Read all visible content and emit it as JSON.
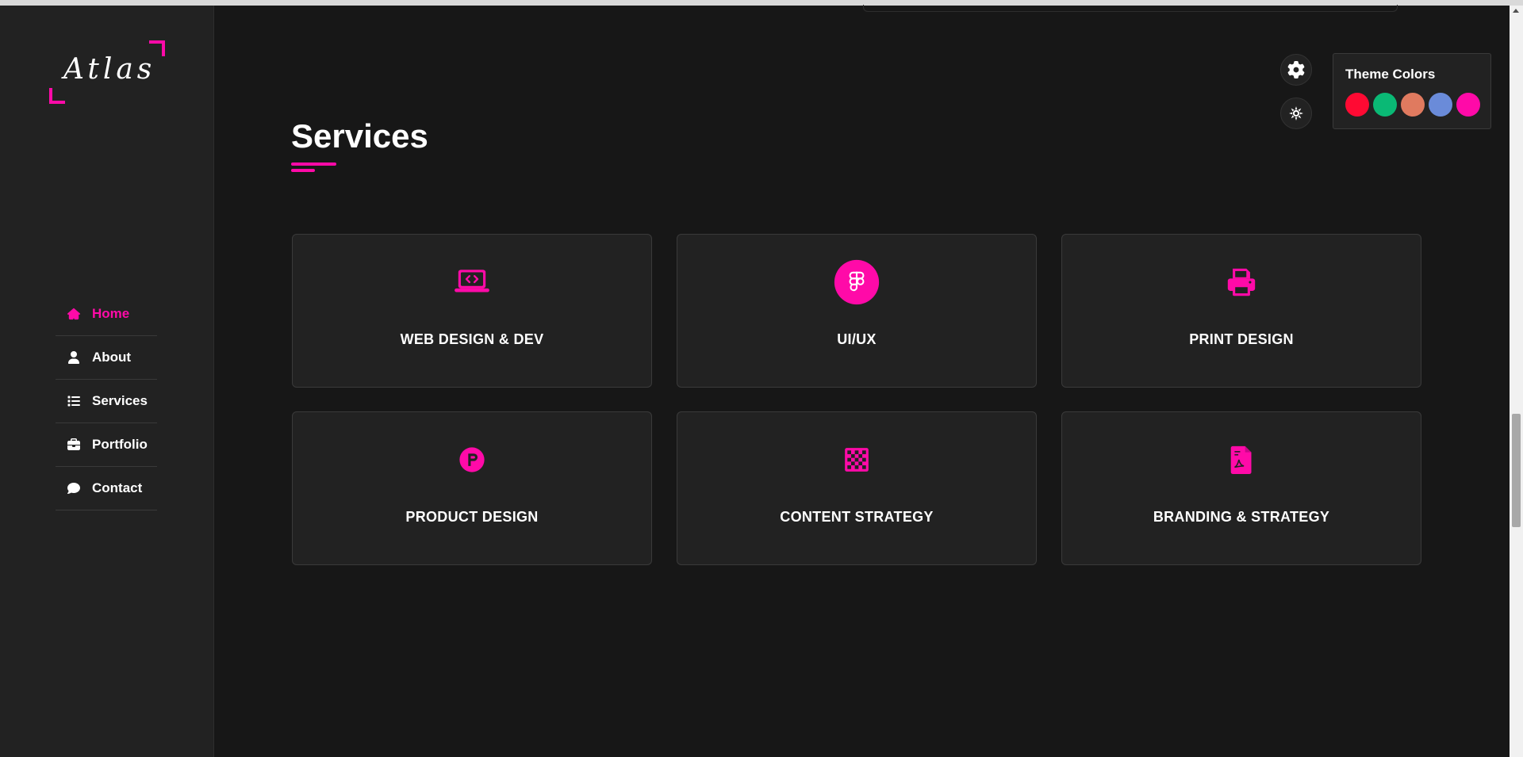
{
  "logo": {
    "text": "Atlas"
  },
  "nav": {
    "items": [
      {
        "label": "Home",
        "icon": "home-icon",
        "active": true
      },
      {
        "label": "About",
        "icon": "user-icon",
        "active": false
      },
      {
        "label": "Services",
        "icon": "list-icon",
        "active": false
      },
      {
        "label": "Portfolio",
        "icon": "briefcase-icon",
        "active": false
      },
      {
        "label": "Contact",
        "icon": "comment-icon",
        "active": false
      }
    ]
  },
  "main": {
    "title": "Services",
    "services": [
      {
        "title": "WEB DESIGN & DEV",
        "icon": "laptop-code-icon"
      },
      {
        "title": "UI/UX",
        "icon": "figma-icon"
      },
      {
        "title": "PRINT DESIGN",
        "icon": "printer-icon"
      },
      {
        "title": "PRODUCT DESIGN",
        "icon": "product-hunt-icon"
      },
      {
        "title": "CONTENT STRATEGY",
        "icon": "chess-board-icon"
      },
      {
        "title": "BRANDING & STRATEGY",
        "icon": "file-pdf-icon"
      }
    ]
  },
  "theme": {
    "title": "Theme Colors",
    "swatches": [
      "#ff0a33",
      "#0ab975",
      "#e07a5f",
      "#6a8bd9",
      "#ff0aa8"
    ],
    "accent": "#ff0aa8"
  }
}
